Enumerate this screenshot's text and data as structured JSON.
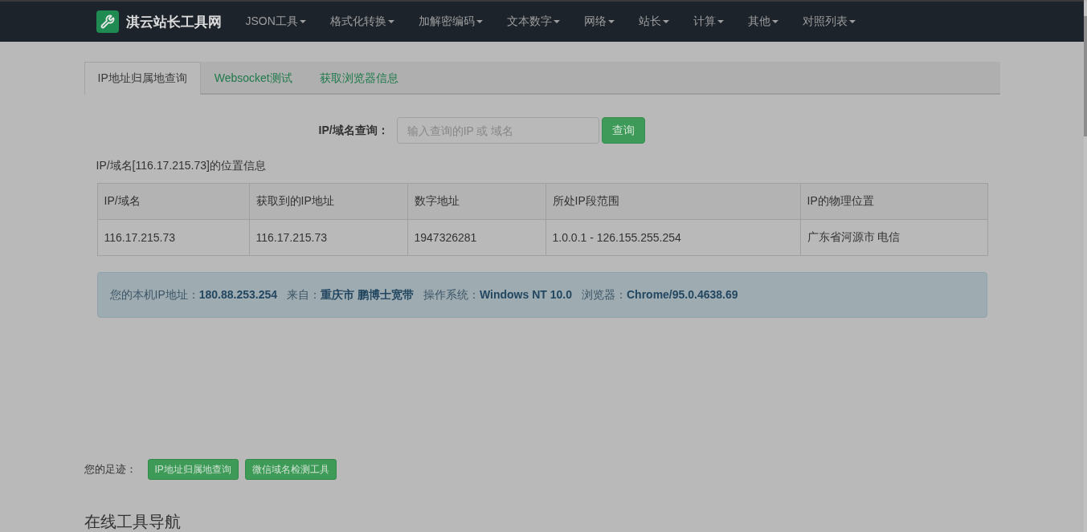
{
  "navbar": {
    "brand": "淇云站长工具网",
    "items": [
      "JSON工具",
      "格式化转换",
      "加解密编码",
      "文本数字",
      "网络",
      "站长",
      "计算",
      "其他",
      "对照列表"
    ]
  },
  "tabs": [
    {
      "label": "IP地址归属地查询",
      "selected": true
    },
    {
      "label": "Websocket测试",
      "selected": false
    },
    {
      "label": "获取浏览器信息",
      "selected": false
    }
  ],
  "query": {
    "label": "IP/域名查询：",
    "placeholder": "输入查询的IP 或 域名",
    "button": "查询"
  },
  "result_title": "IP/域名[116.17.215.73]的位置信息",
  "table": {
    "columns": [
      "IP/域名",
      "获取到的IP地址",
      "数字地址",
      "所处IP段范围",
      "IP的物理位置"
    ],
    "rows": [
      [
        "116.17.215.73",
        "116.17.215.73",
        "1947326281",
        "1.0.0.1 - 126.155.255.254",
        "广东省河源市 电信"
      ]
    ]
  },
  "alert": {
    "items": [
      {
        "label": "您的本机IP地址：",
        "value": "180.88.253.254"
      },
      {
        "label": "来自：",
        "value": "重庆市 鹏博士宽带"
      },
      {
        "label": "操作系统：",
        "value": "Windows NT 10.0"
      },
      {
        "label": "浏览器：",
        "value": "Chrome/95.0.4638.69"
      }
    ]
  },
  "footprints": {
    "label": "您的足迹：",
    "links": [
      "IP地址归属地查询",
      "微信域名检测工具"
    ]
  },
  "section_heading": "在线工具导航"
}
